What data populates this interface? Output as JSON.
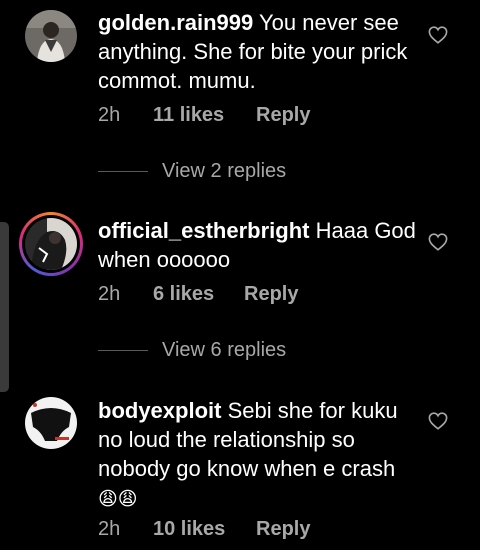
{
  "comments": [
    {
      "username": "golden.rain999",
      "text": "You never see anything. She for bite your prick commot. mumu.",
      "time": "2h",
      "likes": "11 likes",
      "reply": "Reply"
    },
    {
      "username": "official_estherbright",
      "text": "Haaa God when oooooo",
      "time": "2h",
      "likes": "6 likes",
      "reply": "Reply"
    },
    {
      "username": "bodyexploit",
      "text": "Sebi she for kuku no loud the relationship so nobody go know when e crash",
      "emoji": "😩😩",
      "time": "2h",
      "likes": "10 likes",
      "reply": "Reply"
    }
  ],
  "view_replies": [
    {
      "label": "View 2 replies"
    },
    {
      "label": "View 6 replies"
    }
  ],
  "colors": {
    "background": "#000000",
    "text": "#ffffff",
    "secondary": "#a8a8a8"
  },
  "icons": {
    "like": "heart-outline-icon"
  }
}
